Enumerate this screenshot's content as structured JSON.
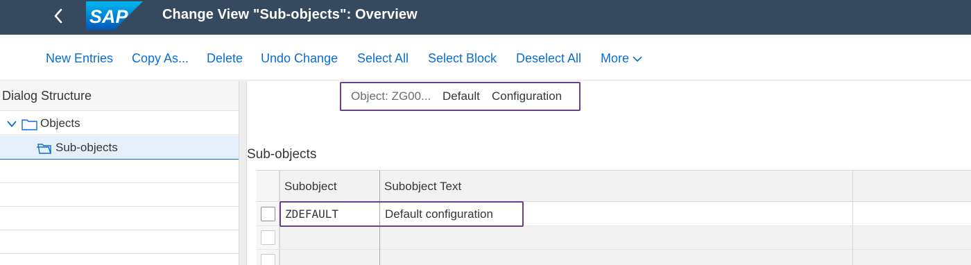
{
  "header": {
    "title": "Change View \"Sub-objects\": Overview",
    "logo_text": "SAP",
    "brand_color": "#354a5f"
  },
  "toolbar": {
    "new_entries": "New Entries",
    "copy_as": "Copy As...",
    "delete": "Delete",
    "undo_change": "Undo Change",
    "select_all": "Select All",
    "select_block": "Select Block",
    "deselect_all": "Deselect All",
    "more": "More"
  },
  "dialog_structure": {
    "title": "Dialog Structure",
    "items": [
      {
        "label": "Objects",
        "icon": "folder-icon",
        "expanded": true
      },
      {
        "label": "Sub-objects",
        "icon": "open-folder-icon",
        "selected": true
      }
    ]
  },
  "object_header": {
    "label": "Object: ZG00...",
    "value_1": "Default",
    "value_2": "Configuration"
  },
  "section": {
    "title": "Sub-objects"
  },
  "table": {
    "columns": [
      "Subobject",
      "Subobject Text"
    ],
    "rows": [
      {
        "subobject": "ZDEFAULT",
        "text": "Default configuration"
      }
    ]
  },
  "colors": {
    "link": "#0a6ed1",
    "highlight": "#6c3e8e",
    "selection": "#e5f0fa"
  }
}
